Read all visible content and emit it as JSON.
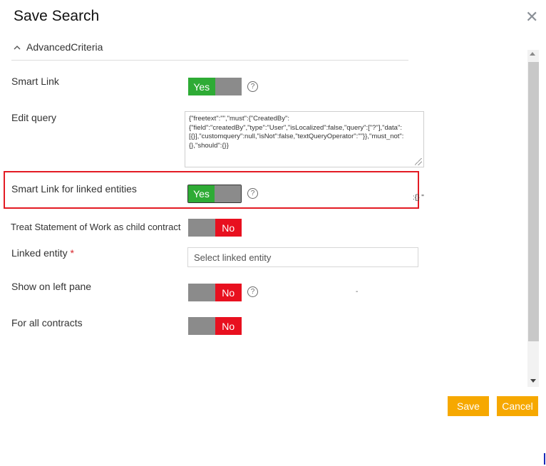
{
  "dialog": {
    "title": "Save Search",
    "close_symbol": "✕",
    "section_title": "AdvancedCriteria",
    "section_icon": "chevron-up-icon"
  },
  "fields": {
    "smart_link": {
      "label": "Smart Link",
      "value": "Yes"
    },
    "edit_query": {
      "label": "Edit query",
      "value": "{\"freetext\":\"\",\"must\":{\"CreatedBy\":{\"field\":\"createdBy\",\"type\":\"User\",\"isLocalized\":false,\"query\":[\"?\"],\"data\":[{}],\"customquery\":null,\"isNot\":false,\"textQueryOperator\":\"\"}},\"must_not\":{},\"should\":{}}"
    },
    "smart_link_linked": {
      "label": "Smart Link for linked entities",
      "value": "Yes"
    },
    "treat_sow": {
      "label": "Treat Statement of Work as child contract",
      "value": "No"
    },
    "linked_entity": {
      "label": "Linked entity",
      "required_mark": "*",
      "placeholder": "Select linked entity"
    },
    "show_left_pane": {
      "label": "Show on left pane",
      "value": "No"
    },
    "for_all_contracts": {
      "label": "For all contracts",
      "value": "No"
    }
  },
  "help_symbol": "?",
  "stray_text": {
    "a": ":{}",
    "b": "\"",
    "c": "-"
  },
  "buttons": {
    "save": "Save",
    "cancel": "Cancel"
  },
  "colors": {
    "yes": "#2eab35",
    "no": "#e8101f",
    "off": "#8b8b8b",
    "accent": "#f6a800",
    "highlight": "#e31b23"
  }
}
